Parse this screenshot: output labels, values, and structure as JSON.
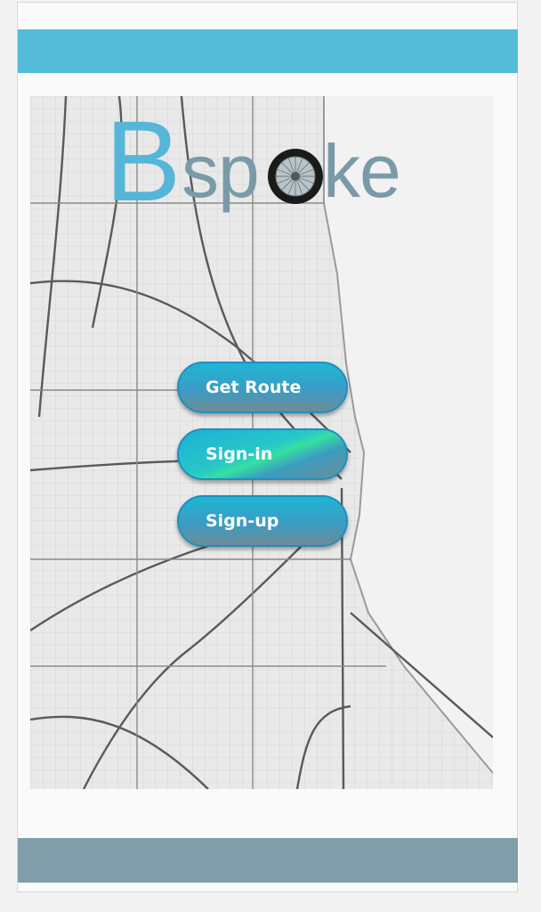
{
  "app": {
    "logo_b": "B",
    "logo_sp": "sp",
    "logo_ke": "ke",
    "brand_color_primary": "#55b6d8",
    "brand_color_secondary": "#7a9aa8"
  },
  "header": {
    "color": "#54bcd8"
  },
  "footer": {
    "color": "#7f9ea9"
  },
  "map": {
    "icon": "city-street-map"
  },
  "buttons": {
    "get_route": "Get Route",
    "sign_in": "Sign-in",
    "sign_up": "Sign-up"
  }
}
